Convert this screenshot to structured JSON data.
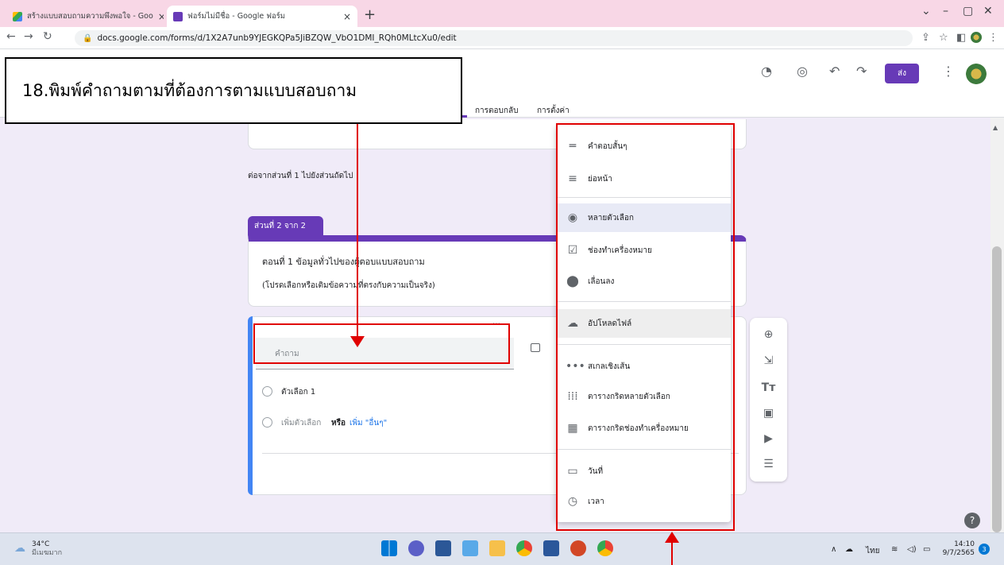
{
  "browser": {
    "tabs": [
      {
        "title": "สร้างแบบสอบถามความพึงพอใจ - Goo",
        "active": false
      },
      {
        "title": "ฟอร์มไม่มีชื่อ - Google ฟอร์ม",
        "active": true
      }
    ],
    "url": "docs.google.com/forms/d/1X2A7unb9YJEGKQPa5JiBZQW_VbO1DMI_RQh0MLtcXu0/edit"
  },
  "header": {
    "send_label": "ส่ง",
    "tabs": [
      "การตอบกลับ",
      "การตั้งค่า"
    ]
  },
  "callout": {
    "text": "18.พิมพ์คำถามตามที่ต้องการตามแบบสอบถาม"
  },
  "form": {
    "after_section": "ต่อจากส่วนที่ 1   ไปยังส่วนถัดไป",
    "section_badge": "ส่วนที่ 2 จาก 2",
    "section_title": "ตอนที่ 1  ข้อมูลทั่วไปของผู้ตอบแบบสอบถาม",
    "section_desc": "(โปรดเลือกหรือเติมข้อความที่ตรงกับความเป็นจริง)",
    "question_placeholder": "คำถาม",
    "option1": "ตัวเลือก 1",
    "add_option": "เพิ่มตัวเลือก",
    "or": "หรือ",
    "add_other": "เพิ่ม \"อื่นๆ\""
  },
  "menu": {
    "items": [
      {
        "label": "คำตอบสั้นๆ",
        "icon": "short-answer-icon"
      },
      {
        "label": "ย่อหน้า",
        "icon": "paragraph-icon"
      },
      {
        "label": "หลายตัวเลือก",
        "icon": "radio-icon"
      },
      {
        "label": "ช่องทำเครื่องหมาย",
        "icon": "checkbox-icon"
      },
      {
        "label": "เลื่อนลง",
        "icon": "dropdown-icon"
      },
      {
        "label": "อัปโหลดไฟล์",
        "icon": "upload-icon"
      },
      {
        "label": "สเกลเชิงเส้น",
        "icon": "linear-scale-icon"
      },
      {
        "label": "ตารางกริดหลายตัวเลือก",
        "icon": "grid-icon"
      },
      {
        "label": "ตารางกริดช่องทำเครื่องหมาย",
        "icon": "checkbox-grid-icon"
      },
      {
        "label": "วันที่",
        "icon": "calendar-icon"
      },
      {
        "label": "เวลา",
        "icon": "clock-icon"
      }
    ]
  },
  "taskbar": {
    "weather_temp": "34°C",
    "weather_desc": "มีเมฆมาก",
    "lang": "ไทย",
    "time": "14:10",
    "date": "9/7/2565",
    "badge": "3"
  }
}
